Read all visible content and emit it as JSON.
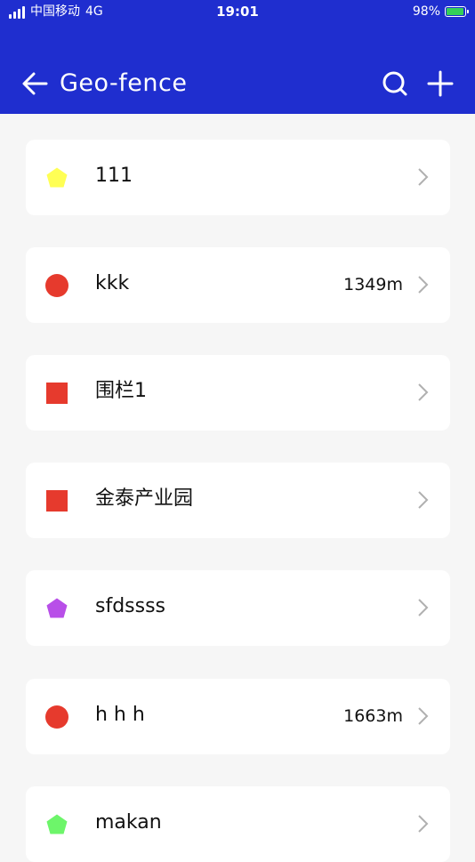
{
  "status_bar": {
    "carrier": "中国移动",
    "network": "4G",
    "time": "19:01",
    "battery": "98%"
  },
  "header": {
    "title": "Geo-fence",
    "color": "#1f2ecf"
  },
  "fences": [
    {
      "name": "111",
      "distance": "",
      "shape": "pentagon",
      "color": "#ffff55"
    },
    {
      "name": "kkk",
      "distance": "1349m",
      "shape": "circle",
      "color": "#e63a2d"
    },
    {
      "name": "围栏1",
      "distance": "",
      "shape": "square",
      "color": "#e63a2d"
    },
    {
      "name": "金泰产业园",
      "distance": "",
      "shape": "square",
      "color": "#e63a2d"
    },
    {
      "name": "sfdssss",
      "distance": "",
      "shape": "pentagon",
      "color": "#b84fe8"
    },
    {
      "name": "h h h",
      "distance": "1663m",
      "shape": "circle",
      "color": "#e63a2d"
    },
    {
      "name": "makan",
      "distance": "",
      "shape": "pentagon",
      "color": "#6df56a"
    }
  ]
}
